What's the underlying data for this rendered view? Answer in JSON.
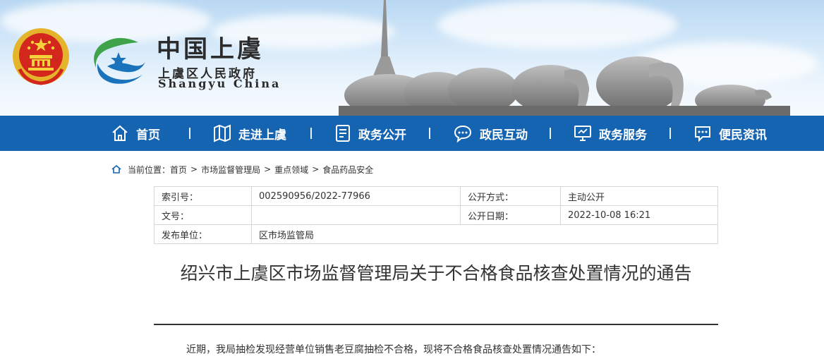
{
  "header": {
    "title": "中国上虞",
    "subtitle": "上虞区人民政府",
    "subtitle_en": "Shangyu  China",
    "colors": {
      "banner_sky": "#c9e1f6",
      "emblem_red": "#d3261d",
      "emblem_gold": "#f2c12e",
      "logo_green": "#3ea34a",
      "logo_blue": "#1b74bb"
    }
  },
  "nav": {
    "color": "#1464b2",
    "items": [
      {
        "label": "首页",
        "icon": "home-icon"
      },
      {
        "label": "走进上虞",
        "icon": "map-icon"
      },
      {
        "label": "政务公开",
        "icon": "document-icon"
      },
      {
        "label": "政民互动",
        "icon": "chat-icon"
      },
      {
        "label": "政务服务",
        "icon": "monitor-icon"
      },
      {
        "label": "便民资讯",
        "icon": "message-icon"
      }
    ],
    "separator": "|"
  },
  "breadcrumb": {
    "prefix": "当前位置：",
    "items": [
      "首页",
      "市场监督管理局",
      "重点领域",
      "食品药品安全"
    ],
    "sep": ">"
  },
  "meta": {
    "index_label": "索引号：",
    "index_value": "002590956/2022-77966",
    "open_mode_label": "公开方式：",
    "open_mode_value": "主动公开",
    "doc_no_label": "文号：",
    "doc_no_value": "",
    "open_date_label": "公开日期：",
    "open_date_value": "2022-10-08 16:21",
    "publisher_label": "发布单位：",
    "publisher_value": "区市场监管局"
  },
  "article": {
    "title": "绍兴市上虞区市场监督管理局关于不合格食品核查处置情况的通告",
    "intro": "近期，我局抽检发现经营单位销售老豆腐抽检不合格，现将不合格食品核查处置情况通告如下："
  }
}
